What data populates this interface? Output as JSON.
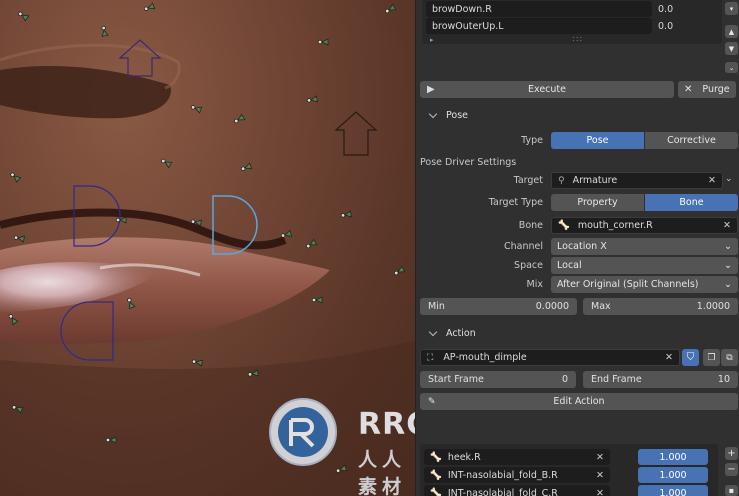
{
  "shape_list": {
    "rows": [
      {
        "name": "browDown.R",
        "value": "0.0"
      },
      {
        "name": "browOuterUp.L",
        "value": "0.0"
      }
    ]
  },
  "execute": {
    "label": "Execute"
  },
  "purge": {
    "label": "Purge"
  },
  "pose": {
    "header": "Pose",
    "type_label": "Type",
    "type_options": [
      "Pose",
      "Corrective"
    ],
    "driver_settings_label": "Pose Driver Settings",
    "target_label": "Target",
    "target_value": "Armature",
    "target_type_label": "Target Type",
    "target_type_options": [
      "Property",
      "Bone"
    ],
    "bone_label": "Bone",
    "bone_value": "mouth_corner.R",
    "channel_label": "Channel",
    "channel_value": "Location X",
    "space_label": "Space",
    "space_value": "Local",
    "mix_label": "Mix",
    "mix_value": "After Original (Split Channels)",
    "min_label": "Min",
    "min_value": "0.0000",
    "max_label": "Max",
    "max_value": "1.0000"
  },
  "action": {
    "header": "Action",
    "name": "AP-mouth_dimple",
    "start_frame_label": "Start Frame",
    "start_frame_value": "0",
    "end_frame_label": "End Frame",
    "end_frame_value": "10",
    "edit_label": "Edit Action",
    "bone_rows": [
      {
        "name": "heek.R",
        "value": "1.000"
      },
      {
        "name": "INT-nasolabial_fold_B.R",
        "value": "1.000"
      },
      {
        "name": "INT-nasolabial_fold_C.R",
        "value": "1.000"
      }
    ]
  },
  "watermark": {
    "line1": "RRCG",
    "line2": "人人素材"
  },
  "colors": {
    "accent": "#4772b3",
    "panel": "#303030",
    "field": "#545454"
  }
}
